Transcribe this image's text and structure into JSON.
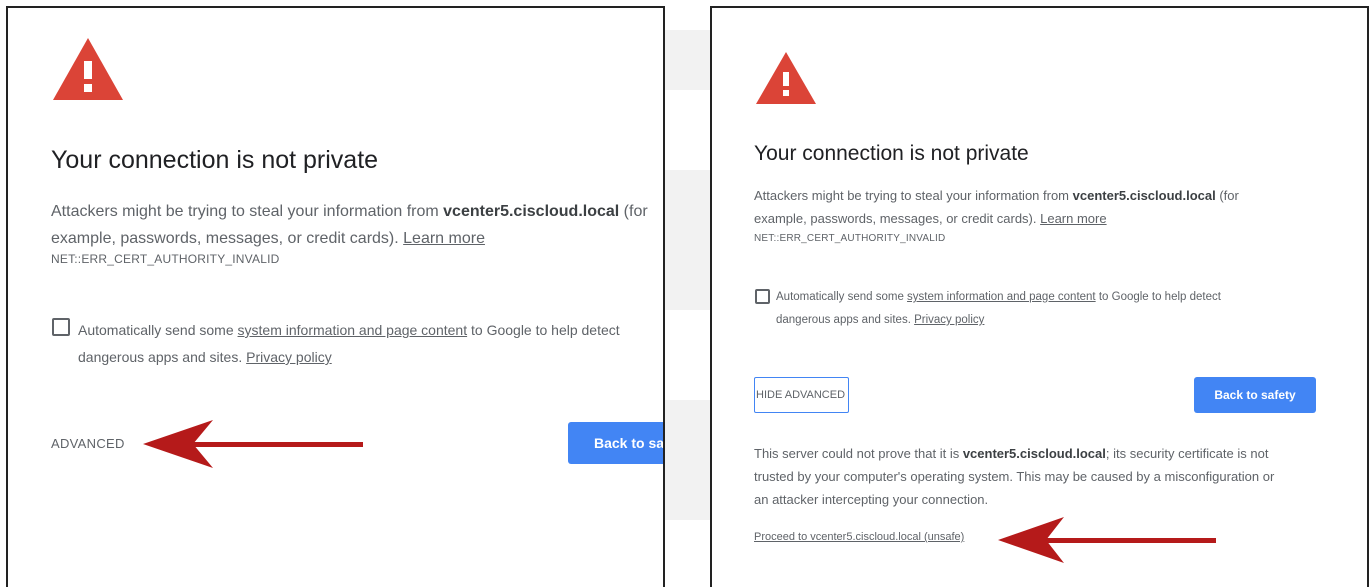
{
  "colors": {
    "warning_red": "#db4437",
    "accent_blue": "#4285f4",
    "annotation_arrow": "#b51a1a",
    "text_gray": "#5f6368"
  },
  "left_panel": {
    "title": "Your connection is not private",
    "body_prefix": "Attackers might be trying to steal your information from ",
    "host": "vcenter5.ciscloud.local",
    "body_suffix_1": " (for",
    "body_line2": "example, passwords, messages, or credit cards). ",
    "learn_more": "Learn more",
    "error_code": "NET::ERR_CERT_AUTHORITY_INVALID",
    "checkbox_prefix": "Automatically send some ",
    "checkbox_link": "system information and page content",
    "checkbox_suffix": " to Google to help detect",
    "checkbox_line2": "dangerous apps and sites. ",
    "privacy_link": "Privacy policy",
    "advanced_label": "ADVANCED",
    "back_label": "Back to safety"
  },
  "right_panel": {
    "title": "Your connection is not private",
    "body_prefix": "Attackers might be trying to steal your information from ",
    "host": "vcenter5.ciscloud.local",
    "body_suffix_1": " (for",
    "body_line2": "example, passwords, messages, or credit cards). ",
    "learn_more": "Learn more",
    "error_code": "NET::ERR_CERT_AUTHORITY_INVALID",
    "checkbox_prefix": "Automatically send some ",
    "checkbox_link": "system information and page content",
    "checkbox_suffix": " to Google to help detect",
    "checkbox_line2": "dangerous apps and sites. ",
    "privacy_link": "Privacy policy",
    "hide_advanced_label": "HIDE ADVANCED",
    "back_label": "Back to safety",
    "details_prefix": "This server could not prove that it is ",
    "details_host": "vcenter5.ciscloud.local",
    "details_suffix": "; its security certificate is not",
    "details_line2": "trusted by your computer's operating system. This may be caused by a misconfiguration or",
    "details_line3": "an attacker intercepting your connection.",
    "proceed_label": "Proceed to vcenter5.ciscloud.local (unsafe)"
  }
}
